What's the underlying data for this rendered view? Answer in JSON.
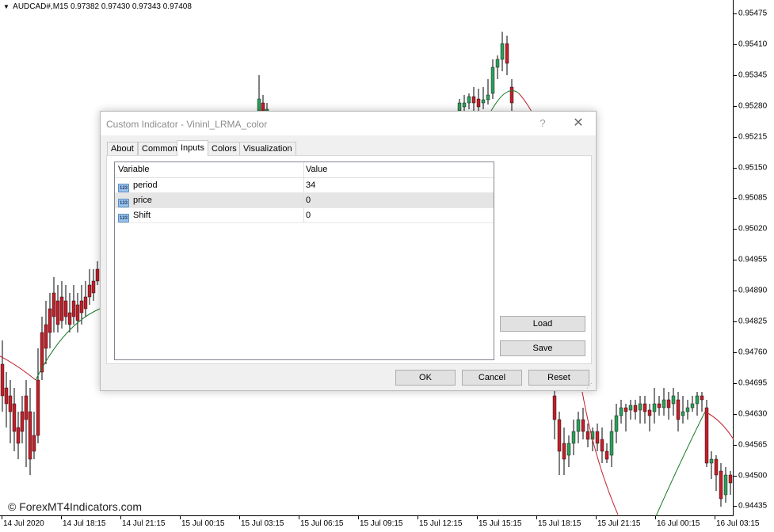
{
  "chart": {
    "symbol_label": "AUDCAD#,M15",
    "ohlc": "0.97382 0.97430 0.97343 0.97408",
    "watermark": "© ForexMT4Indicators.com",
    "colors": {
      "bull": "#2e9e5a",
      "bear": "#c0202a",
      "wick": "#000000",
      "ma_up": "#1a7a2a",
      "ma_down": "#c0202a"
    },
    "price_levels": [
      "0.95475",
      "0.95410",
      "0.95345",
      "0.95280",
      "0.95215",
      "0.95150",
      "0.95085",
      "0.95020",
      "0.94955",
      "0.94890",
      "0.94825",
      "0.94760",
      "0.94695",
      "0.94630",
      "0.94565",
      "0.94500",
      "0.94435"
    ],
    "time_labels": [
      "14 Jul 2020",
      "14 Jul 18:15",
      "14 Jul 21:15",
      "15 Jul 00:15",
      "15 Jul 03:15",
      "15 Jul 06:15",
      "15 Jul 09:15",
      "15 Jul 12:15",
      "15 Jul 15:15",
      "15 Jul 18:15",
      "15 Jul 21:15",
      "16 Jul 00:15",
      "16 Jul 03:15"
    ]
  },
  "dialog": {
    "title": "Custom Indicator - Vininl_LRMA_color",
    "help_icon": "?",
    "close_icon": "✕",
    "tabs": [
      {
        "label": "About"
      },
      {
        "label": "Common"
      },
      {
        "label": "Inputs"
      },
      {
        "label": "Colors"
      },
      {
        "label": "Visualization"
      }
    ],
    "active_tab": "Inputs",
    "table": {
      "headers": {
        "variable": "Variable",
        "value": "Value"
      },
      "icon_text": "123",
      "rows": [
        {
          "variable": "period",
          "value": "34"
        },
        {
          "variable": "price",
          "value": "0"
        },
        {
          "variable": "Shift",
          "value": "0"
        }
      ]
    },
    "buttons": {
      "load": "Load",
      "save": "Save",
      "ok": "OK",
      "cancel": "Cancel",
      "reset": "Reset"
    }
  }
}
